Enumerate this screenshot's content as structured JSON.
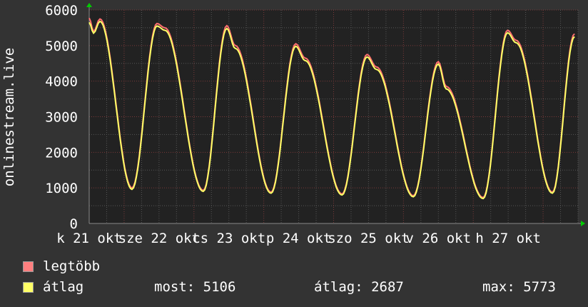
{
  "chart_data": {
    "type": "line",
    "ylabel": "onlinestream.live",
    "ylim": [
      0,
      6000
    ],
    "yticks": [
      "0",
      "1000",
      "2000",
      "3000",
      "4000",
      "5000",
      "6000"
    ],
    "xunit": "hours since 21 okt 12:00",
    "xlim": [
      0,
      168
    ],
    "xtick_labels": [
      "k 21 okt",
      "sze 22 okt",
      "cs 23 okt",
      "p 24 okt",
      "szo 25 okt",
      "v 26 okt",
      "h 27 okt"
    ],
    "series": [
      {
        "name": "legtöbb",
        "color": "#ff7070",
        "points": [
          [
            0,
            5773
          ],
          [
            1.5,
            5400
          ],
          [
            3.7,
            5750
          ],
          [
            14.7,
            1000
          ],
          [
            23.3,
            5620
          ],
          [
            26,
            5500
          ],
          [
            39.2,
            930
          ],
          [
            47.3,
            5560
          ],
          [
            50.2,
            5000
          ],
          [
            62.5,
            880
          ],
          [
            71,
            5050
          ],
          [
            74.2,
            4650
          ],
          [
            86.9,
            830
          ],
          [
            95.5,
            4750
          ],
          [
            98.7,
            4400
          ],
          [
            111.4,
            780
          ],
          [
            120,
            4550
          ],
          [
            122.7,
            3850
          ],
          [
            135.4,
            730
          ],
          [
            143.8,
            5430
          ],
          [
            146.7,
            5150
          ],
          [
            159.2,
            880
          ],
          [
            166.8,
            5330
          ]
        ]
      },
      {
        "name": "átlag",
        "color": "#ffff66",
        "points": [
          [
            0,
            5650
          ],
          [
            1.5,
            5350
          ],
          [
            3.7,
            5680
          ],
          [
            14.7,
            960
          ],
          [
            23.3,
            5550
          ],
          [
            26,
            5430
          ],
          [
            39.2,
            900
          ],
          [
            47.3,
            5480
          ],
          [
            50.2,
            4920
          ],
          [
            62.5,
            850
          ],
          [
            71,
            4980
          ],
          [
            74.2,
            4580
          ],
          [
            86.9,
            800
          ],
          [
            95.5,
            4680
          ],
          [
            98.7,
            4330
          ],
          [
            111.4,
            750
          ],
          [
            120,
            4480
          ],
          [
            122.7,
            3780
          ],
          [
            135.4,
            700
          ],
          [
            143.8,
            5360
          ],
          [
            146.7,
            5080
          ],
          [
            159.2,
            850
          ],
          [
            166.8,
            5250
          ]
        ]
      }
    ]
  },
  "legend": {
    "max_label": "legtöbb",
    "avg_label": "átlag",
    "most": "most: 5106",
    "atlag": "átlag: 2687",
    "max": "max: 5773"
  }
}
